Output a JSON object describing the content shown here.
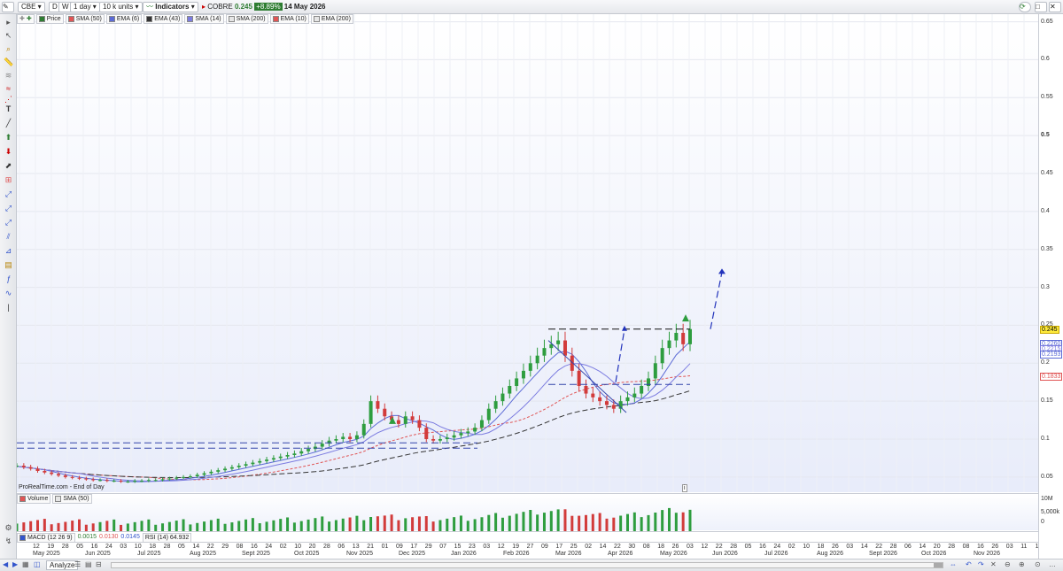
{
  "toolbar": {
    "symbol": "CBE",
    "period_d": "D",
    "period_w": "W",
    "interval": "1 day",
    "units": "10 k units",
    "indicators": "Indicators",
    "instrument": "COBRE",
    "price": "0.245",
    "change": "+8.89%",
    "date": "14 May 2026"
  },
  "legend": [
    {
      "label": "Price",
      "color": "#2e7d32"
    },
    {
      "label": "SMA (50)",
      "color": "#e05555"
    },
    {
      "label": "EMA (6)",
      "color": "#5c6bd6"
    },
    {
      "label": "EMA (43)",
      "color": "#333333"
    },
    {
      "label": "SMA (14)",
      "color": "#7c7ce0"
    },
    {
      "label": "SMA (200)",
      "color": "#e6e6e6"
    },
    {
      "label": "EMA (10)",
      "color": "#e05555"
    },
    {
      "label": "EMA (200)",
      "color": "#e6e6e6"
    }
  ],
  "source_label": "ProRealTime.com - End of Day",
  "volume_legend": [
    {
      "label": "Volume",
      "color": "#e05555"
    },
    {
      "label": "SMA (50)",
      "color": "#e6e6e6"
    }
  ],
  "indicators": {
    "macd_label": "MACD (12 26 9)",
    "macd_v1": "0.0015",
    "macd_v2": "0.0130",
    "macd_v3": "0.0145",
    "rsi_label": "RSI (14)",
    "rsi_value": "64.932"
  },
  "volume_axis": [
    "10M",
    "5,000k",
    "0"
  ],
  "price_axis": [
    "0.65",
    "0.6",
    "0.55",
    "0.5",
    "0.45",
    "0.4",
    "0.35",
    "0.3",
    "0.25",
    "0.2",
    "0.15",
    "0.1",
    "0.05"
  ],
  "price_labels": [
    {
      "text": "0.245",
      "bg": "#ffeb3b",
      "fg": "#000"
    },
    {
      "text": "0.2260",
      "bg": "#ffffff",
      "fg": "#5c6bd6"
    },
    {
      "text": "0.2215",
      "bg": "#ffffff",
      "fg": "#7c7ce0"
    },
    {
      "text": "0.2193",
      "bg": "#ffffff",
      "fg": "#5c6bd6"
    },
    {
      "text": "0.1833",
      "bg": "#ffffff",
      "fg": "#e05555"
    }
  ],
  "x_ticks": [
    "12",
    "19",
    "28",
    "05",
    "16",
    "24",
    "03",
    "10",
    "18",
    "28",
    "05",
    "14",
    "22",
    "29",
    "08",
    "16",
    "24",
    "02",
    "10",
    "20",
    "28",
    "06",
    "13",
    "21",
    "01",
    "09",
    "17",
    "29",
    "07",
    "15",
    "23",
    "03",
    "12",
    "19",
    "27",
    "09",
    "17",
    "25",
    "02",
    "14",
    "22",
    "30",
    "08",
    "18",
    "26",
    "03",
    "12",
    "22",
    "28",
    "05",
    "16",
    "24",
    "02",
    "10",
    "18",
    "26",
    "03",
    "14",
    "22",
    "28",
    "06",
    "14",
    "20",
    "28",
    "08",
    "16",
    "26",
    "03",
    "11",
    "19"
  ],
  "x_months": [
    "May 2025",
    "Jun 2025",
    "Jul 2025",
    "Aug 2025",
    "Sept 2025",
    "Oct 2025",
    "Nov 2025",
    "Dec 2025",
    "Jan 2026",
    "Feb 2026",
    "Mar 2026",
    "Apr 2026",
    "May 2026",
    "Jun 2026",
    "Jul 2026",
    "Aug 2026",
    "Sept 2026",
    "Oct 2026",
    "Nov 2026"
  ],
  "bottom": {
    "analyze": "Analyze"
  },
  "chart_data": {
    "type": "candlestick",
    "instrument": "COBRE",
    "ylim": [
      0.03,
      0.66
    ],
    "last_price": 0.245,
    "close_series": [
      0.065,
      0.063,
      0.061,
      0.058,
      0.056,
      0.054,
      0.052,
      0.05,
      0.049,
      0.048,
      0.047,
      0.046,
      0.046,
      0.045,
      0.045,
      0.044,
      0.044,
      0.045,
      0.045,
      0.046,
      0.046,
      0.047,
      0.048,
      0.049,
      0.05,
      0.051,
      0.053,
      0.055,
      0.057,
      0.059,
      0.061,
      0.063,
      0.065,
      0.067,
      0.069,
      0.071,
      0.073,
      0.075,
      0.077,
      0.079,
      0.081,
      0.084,
      0.087,
      0.09,
      0.094,
      0.098,
      0.1,
      0.103,
      0.1,
      0.105,
      0.12,
      0.15,
      0.14,
      0.13,
      0.125,
      0.12,
      0.13,
      0.125,
      0.115,
      0.1,
      0.098,
      0.1,
      0.102,
      0.105,
      0.108,
      0.11,
      0.115,
      0.125,
      0.14,
      0.15,
      0.16,
      0.17,
      0.18,
      0.19,
      0.2,
      0.21,
      0.22,
      0.225,
      0.23,
      0.21,
      0.19,
      0.17,
      0.16,
      0.155,
      0.15,
      0.145,
      0.14,
      0.15,
      0.155,
      0.16,
      0.17,
      0.18,
      0.2,
      0.22,
      0.23,
      0.24,
      0.225,
      0.245
    ]
  }
}
